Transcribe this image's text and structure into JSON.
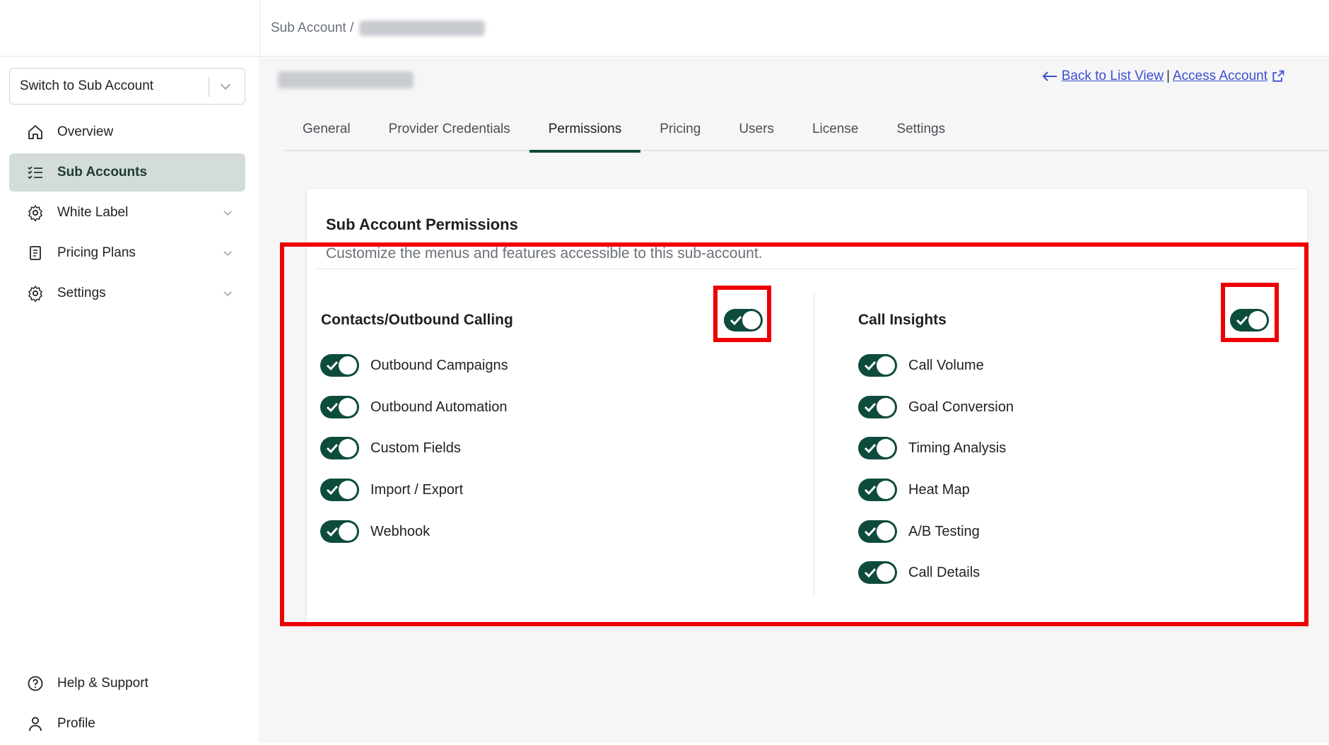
{
  "sidebar": {
    "switch_select": {
      "label": "Switch to Sub Account"
    },
    "items": [
      {
        "label": "Overview",
        "icon": "home-icon",
        "active": false,
        "has_caret": false
      },
      {
        "label": "Sub Accounts",
        "icon": "checklist-icon",
        "active": true,
        "has_caret": false
      },
      {
        "label": "White Label",
        "icon": "gear-icon",
        "active": false,
        "has_caret": true
      },
      {
        "label": "Pricing Plans",
        "icon": "document-icon",
        "active": false,
        "has_caret": true
      },
      {
        "label": "Settings",
        "icon": "gear-icon",
        "active": false,
        "has_caret": true
      }
    ],
    "bottom_items": [
      {
        "label": "Help & Support",
        "icon": "help-icon"
      },
      {
        "label": "Profile",
        "icon": "user-icon"
      }
    ]
  },
  "breadcrumb": {
    "root": "Sub Account /"
  },
  "header": {
    "back_link": "Back to List View",
    "separator": "|",
    "access_link": "Access Account"
  },
  "tabs": [
    {
      "label": "General",
      "active": false
    },
    {
      "label": "Provider Credentials",
      "active": false
    },
    {
      "label": "Permissions",
      "active": true
    },
    {
      "label": "Pricing",
      "active": false
    },
    {
      "label": "Users",
      "active": false
    },
    {
      "label": "License",
      "active": false
    },
    {
      "label": "Settings",
      "active": false
    }
  ],
  "permissions": {
    "title": "Sub Account Permissions",
    "description": "Customize the menus and features accessible to this sub-account.",
    "groups": [
      {
        "title": "Contacts/Outbound Calling",
        "enabled": true,
        "items": [
          {
            "label": "Outbound Campaigns",
            "enabled": true
          },
          {
            "label": "Outbound Automation",
            "enabled": true
          },
          {
            "label": "Custom Fields",
            "enabled": true
          },
          {
            "label": "Import / Export",
            "enabled": true
          },
          {
            "label": "Webhook",
            "enabled": true
          }
        ]
      },
      {
        "title": "Call Insights",
        "enabled": true,
        "items": [
          {
            "label": "Call Volume",
            "enabled": true
          },
          {
            "label": "Goal Conversion",
            "enabled": true
          },
          {
            "label": "Timing Analysis",
            "enabled": true
          },
          {
            "label": "Heat Map",
            "enabled": true
          },
          {
            "label": "A/B Testing",
            "enabled": true
          },
          {
            "label": "Call Details",
            "enabled": true
          }
        ]
      }
    ]
  },
  "colors": {
    "accent": "#0d4b3d",
    "active_nav_bg": "#d3dcd9",
    "link": "#3b4fd1",
    "highlight": "#ef0000"
  }
}
